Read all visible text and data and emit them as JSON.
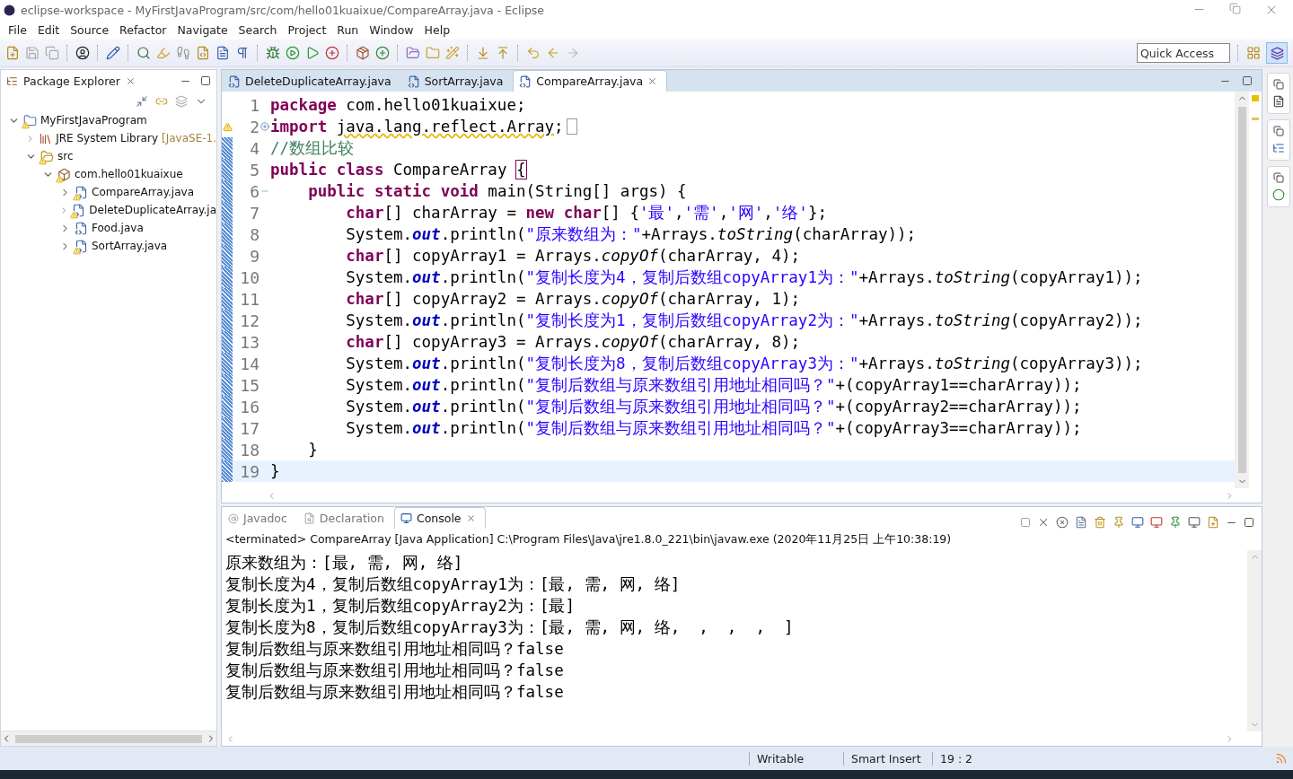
{
  "window": {
    "title": "eclipse-workspace - MyFirstJavaProgram/src/com/hello01kuaixue/CompareArray.java - Eclipse"
  },
  "menu": [
    "File",
    "Edit",
    "Source",
    "Refactor",
    "Navigate",
    "Search",
    "Project",
    "Run",
    "Window",
    "Help"
  ],
  "quick_access": {
    "placeholder": "Quick Access"
  },
  "package_explorer": {
    "title": "Package Explorer",
    "tree": [
      {
        "kind": "project",
        "label": "MyFirstJavaProgram",
        "warning": true,
        "expanded": true,
        "children": [
          {
            "kind": "library",
            "label": "JRE System Library",
            "decoration": "[JavaSE-1.",
            "warning": false,
            "expanded": false
          },
          {
            "kind": "folder",
            "label": "src",
            "warning": true,
            "expanded": true,
            "children": [
              {
                "kind": "package",
                "label": "com.hello01kuaixue",
                "warning": true,
                "expanded": true,
                "children": [
                  {
                    "kind": "java",
                    "label": "CompareArray.java",
                    "warning": true,
                    "expanded": false
                  },
                  {
                    "kind": "java",
                    "label": "DeleteDuplicateArray.ja",
                    "warning": true,
                    "expanded": false
                  },
                  {
                    "kind": "java",
                    "label": "Food.java",
                    "warning": false,
                    "expanded": false
                  },
                  {
                    "kind": "java",
                    "label": "SortArray.java",
                    "warning": true,
                    "expanded": false
                  }
                ]
              }
            ]
          }
        ]
      }
    ]
  },
  "editor": {
    "tabs": [
      {
        "label": "DeleteDuplicateArray.java",
        "selected": false
      },
      {
        "label": "SortArray.java",
        "selected": false
      },
      {
        "label": "CompareArray.java",
        "selected": true
      }
    ],
    "lines": [
      {
        "number": "1",
        "collapsed": false,
        "expanded": false,
        "warning": false,
        "current": false,
        "tokens": [
          {
            "kind": "keyword",
            "text": "package "
          },
          {
            "kind": "plain",
            "text": "com.hello01kuaixue;"
          }
        ]
      },
      {
        "number": "2",
        "collapsed": true,
        "expanded": false,
        "warning": true,
        "current": false,
        "tokens": [
          {
            "kind": "keyword",
            "text": "import "
          },
          {
            "kind": "warning",
            "text": "java.lang.reflect.Array"
          },
          {
            "kind": "plain",
            "text": ";"
          }
        ]
      },
      {
        "number": "4",
        "collapsed": false,
        "expanded": false,
        "warning": false,
        "current": false,
        "tokens": [
          {
            "kind": "comment",
            "text": "//数组比较"
          }
        ]
      },
      {
        "number": "5",
        "collapsed": false,
        "expanded": false,
        "warning": false,
        "current": false,
        "tokens": [
          {
            "kind": "keyword",
            "text": "public "
          },
          {
            "kind": "keyword",
            "text": "class "
          },
          {
            "kind": "plain",
            "text": "CompareArray "
          },
          {
            "kind": "bracket",
            "text": "{"
          }
        ]
      },
      {
        "number": "6",
        "collapsed": false,
        "expanded": true,
        "warning": false,
        "current": false,
        "tokens": [
          {
            "kind": "keyword",
            "text": "    public "
          },
          {
            "kind": "keyword",
            "text": "static "
          },
          {
            "kind": "keyword",
            "text": "void "
          },
          {
            "kind": "plain",
            "text": "main(String[] args) {"
          }
        ]
      },
      {
        "number": "7",
        "collapsed": false,
        "expanded": false,
        "warning": false,
        "current": false,
        "tokens": [
          {
            "kind": "keyword",
            "text": "        char"
          },
          {
            "kind": "plain",
            "text": "[] charArray = "
          },
          {
            "kind": "keyword",
            "text": "new "
          },
          {
            "kind": "keyword",
            "text": "char"
          },
          {
            "kind": "plain",
            "text": "[] {"
          },
          {
            "kind": "string",
            "text": "'最'"
          },
          {
            "kind": "plain",
            "text": ","
          },
          {
            "kind": "string",
            "text": "'需'"
          },
          {
            "kind": "plain",
            "text": ","
          },
          {
            "kind": "string",
            "text": "'网'"
          },
          {
            "kind": "plain",
            "text": ","
          },
          {
            "kind": "string",
            "text": "'络'"
          },
          {
            "kind": "plain",
            "text": "};"
          }
        ]
      },
      {
        "number": "8",
        "collapsed": false,
        "expanded": false,
        "warning": false,
        "current": false,
        "tokens": [
          {
            "kind": "plain",
            "text": "        System."
          },
          {
            "kind": "field",
            "text": "out"
          },
          {
            "kind": "plain",
            "text": ".println("
          },
          {
            "kind": "string",
            "text": "\"原来数组为：\""
          },
          {
            "kind": "plain",
            "text": "+Arrays."
          },
          {
            "kind": "static",
            "text": "toString"
          },
          {
            "kind": "plain",
            "text": "(charArray));"
          }
        ]
      },
      {
        "number": "9",
        "collapsed": false,
        "expanded": false,
        "warning": false,
        "current": false,
        "tokens": [
          {
            "kind": "keyword",
            "text": "        char"
          },
          {
            "kind": "plain",
            "text": "[] copyArray1 = Arrays."
          },
          {
            "kind": "static",
            "text": "copyOf"
          },
          {
            "kind": "plain",
            "text": "(charArray, 4);"
          }
        ]
      },
      {
        "number": "10",
        "collapsed": false,
        "expanded": false,
        "warning": false,
        "current": false,
        "tokens": [
          {
            "kind": "plain",
            "text": "        System."
          },
          {
            "kind": "field",
            "text": "out"
          },
          {
            "kind": "plain",
            "text": ".println("
          },
          {
            "kind": "string",
            "text": "\"复制长度为4，复制后数组copyArray1为：\""
          },
          {
            "kind": "plain",
            "text": "+Arrays."
          },
          {
            "kind": "static",
            "text": "toString"
          },
          {
            "kind": "plain",
            "text": "(copyArray1));"
          }
        ]
      },
      {
        "number": "11",
        "collapsed": false,
        "expanded": false,
        "warning": false,
        "current": false,
        "tokens": [
          {
            "kind": "keyword",
            "text": "        char"
          },
          {
            "kind": "plain",
            "text": "[] copyArray2 = Arrays."
          },
          {
            "kind": "static",
            "text": "copyOf"
          },
          {
            "kind": "plain",
            "text": "(charArray, 1);"
          }
        ]
      },
      {
        "number": "12",
        "collapsed": false,
        "expanded": false,
        "warning": false,
        "current": false,
        "tokens": [
          {
            "kind": "plain",
            "text": "        System."
          },
          {
            "kind": "field",
            "text": "out"
          },
          {
            "kind": "plain",
            "text": ".println("
          },
          {
            "kind": "string",
            "text": "\"复制长度为1，复制后数组copyArray2为：\""
          },
          {
            "kind": "plain",
            "text": "+Arrays."
          },
          {
            "kind": "static",
            "text": "toString"
          },
          {
            "kind": "plain",
            "text": "(copyArray2));"
          }
        ]
      },
      {
        "number": "13",
        "collapsed": false,
        "expanded": false,
        "warning": false,
        "current": false,
        "tokens": [
          {
            "kind": "keyword",
            "text": "        char"
          },
          {
            "kind": "plain",
            "text": "[] copyArray3 = Arrays."
          },
          {
            "kind": "static",
            "text": "copyOf"
          },
          {
            "kind": "plain",
            "text": "(charArray, 8);"
          }
        ]
      },
      {
        "number": "14",
        "collapsed": false,
        "expanded": false,
        "warning": false,
        "current": false,
        "tokens": [
          {
            "kind": "plain",
            "text": "        System."
          },
          {
            "kind": "field",
            "text": "out"
          },
          {
            "kind": "plain",
            "text": ".println("
          },
          {
            "kind": "string",
            "text": "\"复制长度为8，复制后数组copyArray3为：\""
          },
          {
            "kind": "plain",
            "text": "+Arrays."
          },
          {
            "kind": "static",
            "text": "toString"
          },
          {
            "kind": "plain",
            "text": "(copyArray3));"
          }
        ]
      },
      {
        "number": "15",
        "collapsed": false,
        "expanded": false,
        "warning": false,
        "current": false,
        "tokens": [
          {
            "kind": "plain",
            "text": "        System."
          },
          {
            "kind": "field",
            "text": "out"
          },
          {
            "kind": "plain",
            "text": ".println("
          },
          {
            "kind": "string",
            "text": "\"复制后数组与原来数组引用地址相同吗？\""
          },
          {
            "kind": "plain",
            "text": "+(copyArray1==charArray));"
          }
        ]
      },
      {
        "number": "16",
        "collapsed": false,
        "expanded": false,
        "warning": false,
        "current": false,
        "tokens": [
          {
            "kind": "plain",
            "text": "        System."
          },
          {
            "kind": "field",
            "text": "out"
          },
          {
            "kind": "plain",
            "text": ".println("
          },
          {
            "kind": "string",
            "text": "\"复制后数组与原来数组引用地址相同吗？\""
          },
          {
            "kind": "plain",
            "text": "+(copyArray2==charArray));"
          }
        ]
      },
      {
        "number": "17",
        "collapsed": false,
        "expanded": false,
        "warning": false,
        "current": false,
        "tokens": [
          {
            "kind": "plain",
            "text": "        System."
          },
          {
            "kind": "field",
            "text": "out"
          },
          {
            "kind": "plain",
            "text": ".println("
          },
          {
            "kind": "string",
            "text": "\"复制后数组与原来数组引用地址相同吗？\""
          },
          {
            "kind": "plain",
            "text": "+(copyArray3==charArray));"
          }
        ]
      },
      {
        "number": "18",
        "collapsed": false,
        "expanded": false,
        "warning": false,
        "current": false,
        "tokens": [
          {
            "kind": "plain",
            "text": "    }"
          }
        ]
      },
      {
        "number": "19",
        "collapsed": false,
        "expanded": false,
        "warning": false,
        "current": true,
        "tokens": [
          {
            "kind": "plain",
            "text": "}"
          }
        ]
      }
    ]
  },
  "console": {
    "tabs": [
      {
        "label": "Javadoc",
        "selected": false
      },
      {
        "label": "Declaration",
        "selected": false
      },
      {
        "label": "Console",
        "selected": true
      }
    ],
    "header": "<terminated> CompareArray [Java Application] C:\\Program Files\\Java\\jre1.8.0_221\\bin\\javaw.exe (2020年11月25日 上午10:38:19)",
    "output": [
      "原来数组为：[最, 需, 网, 络]",
      "复制长度为4，复制后数组copyArray1为：[最, 需, 网, 络]",
      "复制长度为1，复制后数组copyArray2为：[最]",
      "复制长度为8，复制后数组copyArray3为：[最, 需, 网, 络,  ,  ,  ,  ]",
      "复制后数组与原来数组引用地址相同吗？false",
      "复制后数组与原来数组引用地址相同吗？false",
      "复制后数组与原来数组引用地址相同吗？false"
    ]
  },
  "status_bar": [
    "Writable",
    "Smart Insert",
    "19 : 2"
  ]
}
